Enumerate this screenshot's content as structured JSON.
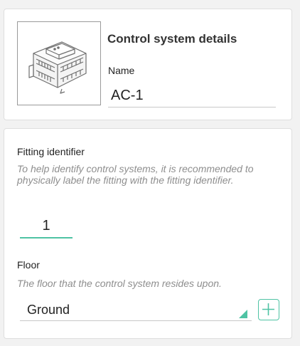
{
  "details": {
    "title": "Control system details",
    "name_label": "Name",
    "name_value": "AC-1",
    "device_image_icon": "din-rail-controller-icon"
  },
  "fitting": {
    "label": "Fitting identifier",
    "help": "To help identify control systems, it is recommended to physically label the fitting with the fitting identifier.",
    "value": "1"
  },
  "floor": {
    "label": "Floor",
    "help": "The floor that the control system resides upon.",
    "selected": "Ground",
    "add_icon": "plus-icon"
  },
  "colors": {
    "accent": "#4fc3a4",
    "help_text": "#8e8e8e",
    "card_border": "#dedede",
    "background": "#f2f2f2"
  }
}
